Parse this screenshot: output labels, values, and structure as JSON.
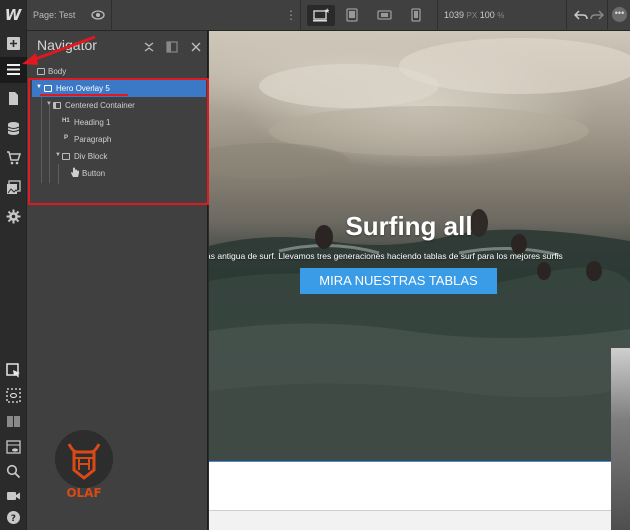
{
  "topbar": {
    "logo": "W",
    "page_prefix": "Page:",
    "page_name": "Test",
    "width_value": "1039",
    "width_unit": "PX",
    "zoom_value": "100",
    "zoom_unit": "%",
    "more": "•••"
  },
  "navigator": {
    "title": "Navigator",
    "items": [
      {
        "label": "Body",
        "type": "box"
      },
      {
        "label": "Hero Overlay 5",
        "type": "box",
        "selected": true
      },
      {
        "label": "Centered Container",
        "type": "box"
      },
      {
        "label": "Heading 1",
        "type": "heading",
        "glyph": "H1"
      },
      {
        "label": "Paragraph",
        "type": "paragraph",
        "glyph": "P"
      },
      {
        "label": "Div Block",
        "type": "box"
      },
      {
        "label": "Button",
        "type": "button"
      }
    ]
  },
  "canvas": {
    "hero_title": "Surfing all",
    "hero_paragraph": "ás antigua de surf. Llevamos tres generaciones haciendo tablas de surf para los mejores surfis",
    "hero_button": "MIRA NUESTRAS TABLAS"
  },
  "watermark": {
    "text": "OLAF"
  },
  "colors": {
    "selection": "#3b79c6",
    "annotation": "#e0181f",
    "button": "#3a9be6",
    "panel": "#404040"
  }
}
